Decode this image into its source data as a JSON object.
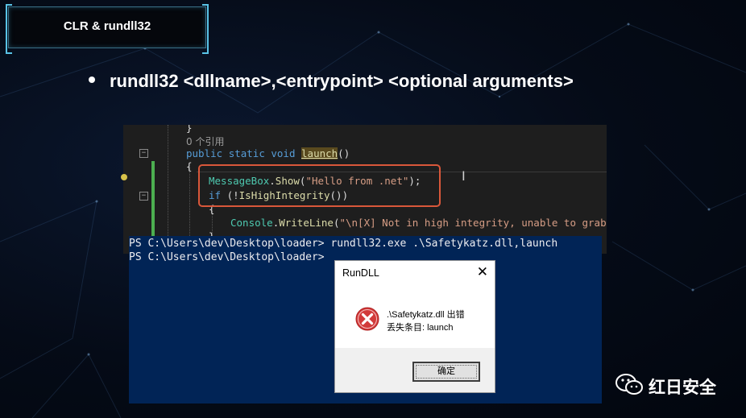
{
  "slide": {
    "title": "CLR & rundll32",
    "bullet": "rundll32 <dllname>,<entrypoint> <optional arguments>"
  },
  "editor": {
    "brace_top": "}",
    "refs": "0 个引用",
    "kw_public": "public",
    "kw_static": "static",
    "kw_void": "void",
    "method_name": "launch",
    "method_parens": "()",
    "open_brace": "{",
    "msg_class": "MessageBox",
    "msg_method": "Show",
    "msg_arg": "\"Hello from .net\"",
    "msg_tail": ");",
    "if_kw": "if",
    "if_cond_open": " (!",
    "if_fn": "IsHighIntegrity",
    "if_cond_close": "())",
    "inner_brace": "{",
    "console_class": "Console",
    "console_method": "WriteLine",
    "console_arg": "\"\\n[X] Not in high integrity, unable to grab a ha",
    "closing": "}"
  },
  "powershell": {
    "line1": "PS C:\\Users\\dev\\Desktop\\loader> rundll32.exe .\\Safetykatz.dll,launch",
    "line2": "PS C:\\Users\\dev\\Desktop\\loader>"
  },
  "dialog": {
    "title": "RunDLL",
    "close_glyph": "✕",
    "message_line1": ".\\Safetykatz.dll 出错",
    "message_line2": "丢失条目: launch",
    "ok_label": "确定",
    "icon": "error-icon"
  },
  "watermark": {
    "text": "红日安全",
    "icon": "wechat-icon"
  },
  "colors": {
    "background": "#050b17",
    "accent": "#59c3e6",
    "highlight_box": "#d9573a",
    "powershell_bg": "#012456",
    "editor_bg": "#1e1e1e"
  }
}
